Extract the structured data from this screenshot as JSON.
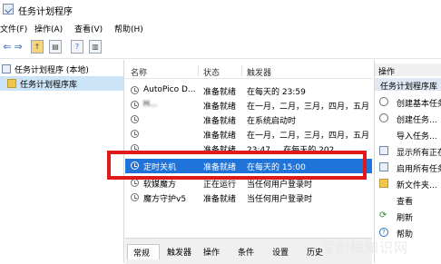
{
  "window": {
    "title": "任务计划程序"
  },
  "menu": [
    "文件(F)",
    "操作(A)",
    "查看(V)",
    "帮助(H)"
  ],
  "tree": {
    "root": "任务计划程序 (本地)",
    "child": "任务计划程序库"
  },
  "list": {
    "headers": [
      "名称",
      "状态",
      "触发器"
    ],
    "rows": [
      {
        "name": "AutoPico D...",
        "status": "准备就绪",
        "trigger": "在每天的 23:59"
      },
      {
        "name": "H...",
        "status": "准备就绪",
        "trigger": "在一月，二月，三月，四月，五月"
      },
      {
        "name": "",
        "status": "准备就绪",
        "trigger": "在系统启动时"
      },
      {
        "name": "",
        "status": "准备就绪",
        "trigger": "在一月，二月，三月，四月，五月"
      },
      {
        "name": "",
        "status": "准备就绪",
        "trigger": "23:47 ... 在每天的 202"
      },
      {
        "name": "定时关机",
        "status": "准备就绪",
        "trigger": "在每天的 15:00"
      },
      {
        "name": "软媒魔方",
        "status": "正在运行",
        "trigger": "当任何用户登录时"
      },
      {
        "name": "魔方守护v5",
        "status": "准备就绪",
        "trigger": "当任何用户登录时"
      }
    ]
  },
  "tabs": [
    "常规",
    "触发器",
    "操作",
    "条件",
    "设置",
    "历史"
  ],
  "actions": {
    "header": "操作",
    "section": "任务计划程序库",
    "items": [
      "创建基本任务...",
      "创建任务...",
      "导入任务...",
      "显示所有正在...",
      "启用所有任务...",
      "新文件夹...",
      "查看",
      "刷新",
      "帮助"
    ]
  },
  "watermark": "爱创根知识网"
}
